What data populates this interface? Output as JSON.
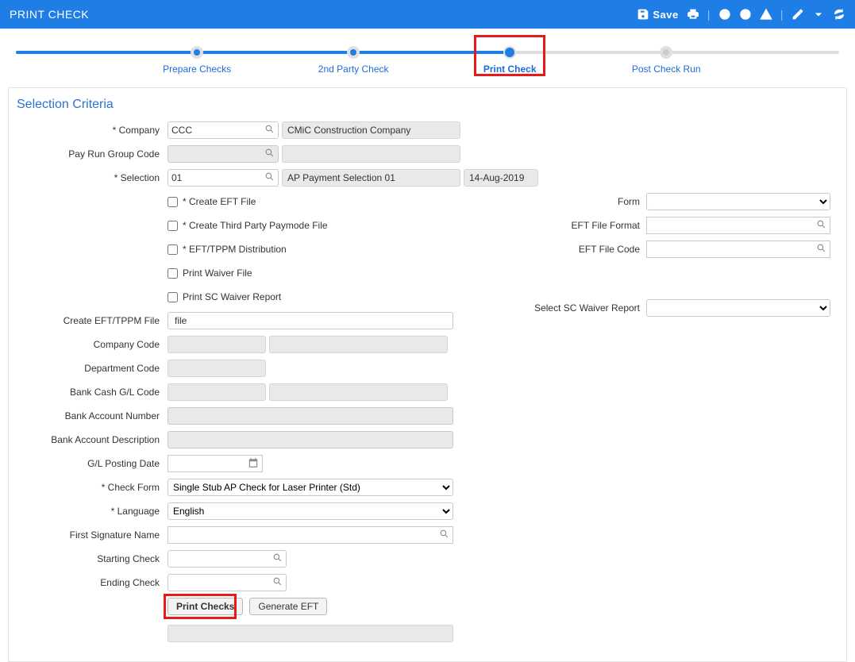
{
  "titlebar": {
    "title": "PRINT CHECK",
    "save": "Save"
  },
  "stepper": {
    "steps": [
      {
        "label": "Prepare Checks",
        "pos": 22
      },
      {
        "label": "2nd Party Check",
        "pos": 41
      },
      {
        "label": "Print Check",
        "pos": 60,
        "active": true
      },
      {
        "label": "Post Check Run",
        "pos": 79
      }
    ],
    "fill_percent": 60
  },
  "section_title": "Selection Criteria",
  "labels": {
    "company": "Company",
    "pay_run_group": "Pay Run Group Code",
    "selection": "Selection",
    "create_eft_tppm_file": "Create EFT/TPPM File",
    "company_code": "Company Code",
    "department_code": "Department Code",
    "bank_cash_gl": "Bank Cash G/L Code",
    "bank_account_number": "Bank Account Number",
    "bank_account_desc": "Bank Account Description",
    "gl_posting_date": "G/L Posting Date",
    "check_form": "Check Form",
    "language": "Language",
    "first_sig": "First Signature Name",
    "starting_check": "Starting Check",
    "ending_check": "Ending Check",
    "form": "Form",
    "eft_format": "EFT File Format",
    "eft_code": "EFT File Code",
    "select_sc_waiver": "Select SC Waiver Report"
  },
  "values": {
    "company_code": "CCC",
    "company_name": "CMiC Construction Company",
    "selection_code": "01",
    "selection_desc": "AP Payment Selection 01",
    "selection_date": "14-Aug-2019",
    "create_eft_tppm_file": "file",
    "check_form": "Single Stub AP Check for Laser Printer (Std)",
    "language": "English"
  },
  "checkboxes": {
    "create_eft": "Create EFT File",
    "create_tppaymode": "Create Third Party Paymode File",
    "eft_tppm_dist": "EFT/TPPM Distribution",
    "print_waiver": "Print Waiver File",
    "print_sc_waiver": "Print SC Waiver Report"
  },
  "buttons": {
    "print_checks": "Print Checks",
    "generate_eft": "Generate EFT"
  }
}
